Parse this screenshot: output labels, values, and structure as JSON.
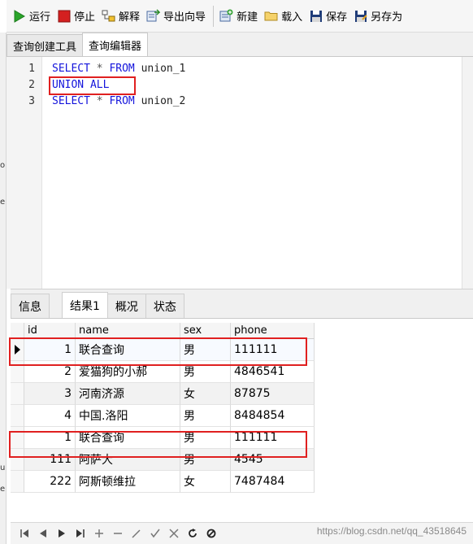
{
  "toolbar": {
    "run": "运行",
    "stop": "停止",
    "explain": "解释",
    "export_wizard": "导出向导",
    "new": "新建",
    "load": "载入",
    "save": "保存",
    "save_as": "另存为"
  },
  "left_strip": {
    "chars": [
      "o",
      "e",
      "u",
      "e"
    ]
  },
  "editor_tabs": [
    {
      "label": "查询创建工具"
    },
    {
      "label": "查询编辑器"
    }
  ],
  "editor": {
    "lines": [
      {
        "num": "1",
        "kw1": "SELECT",
        "op": " * ",
        "kw2": "FROM",
        "ident": " union_1"
      },
      {
        "num": "2",
        "kw1": "UNION ALL",
        "op": "",
        "kw2": "",
        "ident": ""
      },
      {
        "num": "3",
        "kw1": "SELECT",
        "op": " * ",
        "kw2": "FROM",
        "ident": " union_2"
      }
    ]
  },
  "result_tabs": [
    {
      "label": "信息"
    },
    {
      "label": "结果1"
    },
    {
      "label": "概况"
    },
    {
      "label": "状态"
    }
  ],
  "grid": {
    "columns": [
      "id",
      "name",
      "sex",
      "phone"
    ],
    "rows": [
      {
        "id": "1",
        "name": "联合查询",
        "sex": "男",
        "phone": "111111"
      },
      {
        "id": "2",
        "name": "爱猫狗的小郝",
        "sex": "男",
        "phone": "4846541"
      },
      {
        "id": "3",
        "name": "河南济源",
        "sex": "女",
        "phone": "87875"
      },
      {
        "id": "4",
        "name": "中国.洛阳",
        "sex": "男",
        "phone": "8484854"
      },
      {
        "id": "1",
        "name": "联合查询",
        "sex": "男",
        "phone": "111111"
      },
      {
        "id": "111",
        "name": "阿萨大",
        "sex": "男",
        "phone": "4545"
      },
      {
        "id": "222",
        "name": "阿斯顿维拉",
        "sex": "女",
        "phone": "7487484"
      }
    ]
  },
  "watermark": "https://blog.csdn.net/qq_43518645",
  "colors": {
    "keyword": "#1414dc",
    "highlight_box": "#e02020",
    "run_icon": "#2aa52a",
    "stop_icon": "#d42020"
  },
  "icons": {
    "navigator": [
      "first-record-icon",
      "prev-record-icon",
      "next-record-icon",
      "last-record-icon",
      "add-record-icon",
      "delete-record-icon",
      "edit-record-icon",
      "apply-icon",
      "cancel-icon",
      "refresh-icon",
      "stop-icon"
    ]
  }
}
